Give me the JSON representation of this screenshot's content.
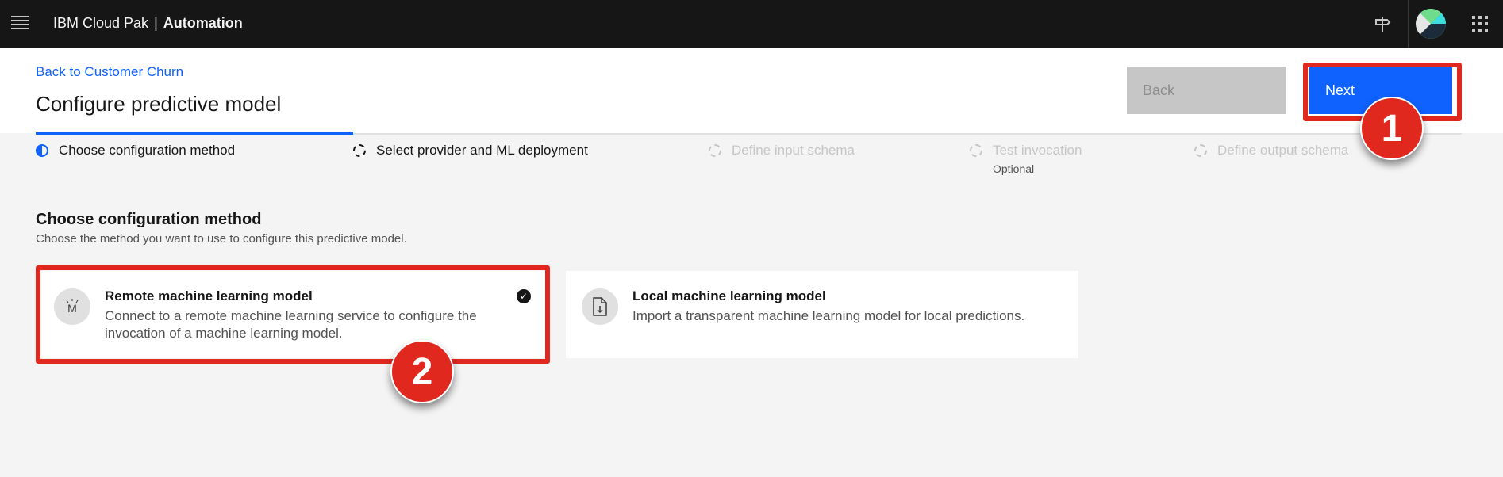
{
  "topbar": {
    "brand_prefix": "IBM Cloud Pak",
    "brand_separator": "|",
    "brand_product": "Automation",
    "icons": [
      "menu-icon",
      "pin-icon",
      "user-avatar",
      "app-switcher-icon"
    ]
  },
  "header": {
    "back_link": "Back to Customer Churn",
    "title": "Configure predictive model",
    "back_button": "Back",
    "next_button": "Next"
  },
  "progress": {
    "steps": [
      {
        "label": "Choose configuration method",
        "state": "current"
      },
      {
        "label": "Select provider and ML deployment",
        "state": "incomplete"
      },
      {
        "label": "Define input schema",
        "state": "disabled"
      },
      {
        "label": "Test invocation",
        "state": "disabled",
        "sub": "Optional"
      },
      {
        "label": "Define output schema",
        "state": "disabled"
      }
    ]
  },
  "main": {
    "section_title": "Choose configuration method",
    "section_desc": "Choose the method you want to use to configure this predictive model.",
    "tiles": [
      {
        "title": "Remote machine learning model",
        "desc": "Connect to a remote machine learning service to configure the invocation of a machine learning model.",
        "icon": "M",
        "selected": true
      },
      {
        "title": "Local machine learning model",
        "desc": "Import a transparent machine learning model for local predictions.",
        "icon": "file-import-icon",
        "selected": false
      }
    ]
  },
  "callouts": [
    "1",
    "2"
  ],
  "colors": {
    "primary": "#0f62fe",
    "callout": "#e0281f",
    "topbar": "#161616"
  }
}
